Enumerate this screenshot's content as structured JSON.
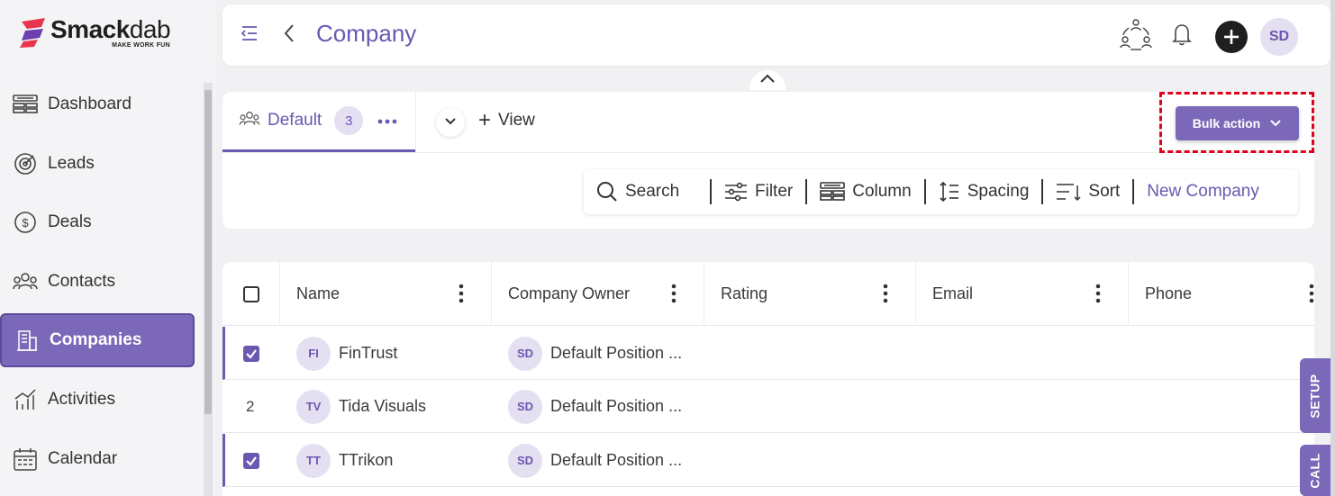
{
  "brand": {
    "name_bold": "Smack",
    "name_light": "dab",
    "tagline": "MAKE WORK FUN",
    "color": "#6b58b0"
  },
  "sidebar": {
    "items": [
      {
        "label": "Dashboard",
        "icon": "dashboard-icon"
      },
      {
        "label": "Leads",
        "icon": "target-icon"
      },
      {
        "label": "Deals",
        "icon": "dollar-icon"
      },
      {
        "label": "Contacts",
        "icon": "people-icon"
      },
      {
        "label": "Companies",
        "icon": "building-icon",
        "active": true
      },
      {
        "label": "Activities",
        "icon": "activity-icon"
      },
      {
        "label": "Calendar",
        "icon": "calendar-icon"
      }
    ]
  },
  "header": {
    "title": "Company",
    "user_initials": "SD"
  },
  "views": {
    "tab_label": "Default",
    "tab_count": "3",
    "add_view_label": "View",
    "bulk_action_label": "Bulk action"
  },
  "toolbar": {
    "search": "Search",
    "filter": "Filter",
    "column": "Column",
    "spacing": "Spacing",
    "sort": "Sort",
    "new_company": "New Company"
  },
  "table": {
    "columns": [
      "Name",
      "Company Owner",
      "Rating",
      "Email",
      "Phone"
    ],
    "rows": [
      {
        "marker": "checked",
        "initials": "FI",
        "name": "FinTrust",
        "owner_initials": "SD",
        "owner": "Default Position ..."
      },
      {
        "marker": "2",
        "initials": "TV",
        "name": "Tida Visuals",
        "owner_initials": "SD",
        "owner": "Default Position ..."
      },
      {
        "marker": "checked",
        "initials": "TT",
        "name": "TTrikon",
        "owner_initials": "SD",
        "owner": "Default Position ..."
      }
    ]
  },
  "side_tabs": {
    "setup": "SETUP",
    "call": "CALL"
  }
}
